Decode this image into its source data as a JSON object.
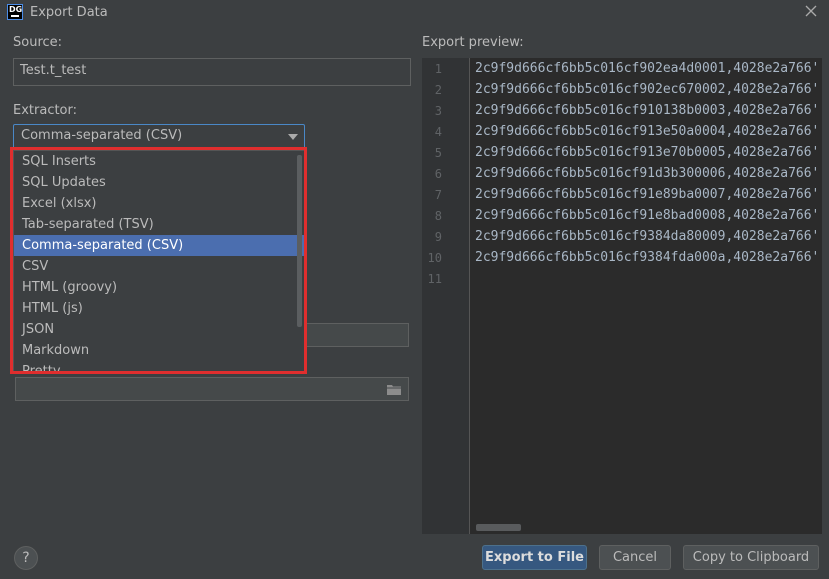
{
  "window": {
    "title": "Export Data",
    "logo_text": "DG"
  },
  "source": {
    "label": "Source:",
    "value": "Test.t_test"
  },
  "extractor": {
    "label": "Extractor:",
    "selected": "Comma-separated (CSV)",
    "options": [
      "SQL Inserts",
      "SQL Updates",
      "Excel (xlsx)",
      "Tab-separated (TSV)",
      "Comma-separated (CSV)",
      "CSV",
      "HTML (groovy)",
      "HTML (js)",
      "JSON",
      "Markdown",
      "Pretty"
    ],
    "selected_index": 4
  },
  "preview": {
    "label": "Export preview:",
    "line_numbers": [
      "1",
      "2",
      "3",
      "4",
      "5",
      "6",
      "7",
      "8",
      "9",
      "10",
      "11"
    ],
    "lines": [
      "2c9f9d666cf6bb5c016cf902ea4d0001,4028e2a766'",
      "2c9f9d666cf6bb5c016cf902ec670002,4028e2a766'",
      "2c9f9d666cf6bb5c016cf910138b0003,4028e2a766'",
      "2c9f9d666cf6bb5c016cf913e50a0004,4028e2a766'",
      "2c9f9d666cf6bb5c016cf913e70b0005,4028e2a766'",
      "2c9f9d666cf6bb5c016cf91d3b300006,4028e2a766'",
      "2c9f9d666cf6bb5c016cf91e89ba0007,4028e2a766'",
      "2c9f9d666cf6bb5c016cf91e8bad0008,4028e2a766'",
      "2c9f9d666cf6bb5c016cf9384da80009,4028e2a766'",
      "2c9f9d666cf6bb5c016cf9384fda000a,4028e2a766'"
    ]
  },
  "buttons": {
    "help": "?",
    "export": "Export to File",
    "cancel": "Cancel",
    "copy": "Copy to Clipboard"
  },
  "colors": {
    "accent": "#4b6eaf",
    "highlight_frame": "#e02e2e",
    "primary_button": "#365880"
  }
}
